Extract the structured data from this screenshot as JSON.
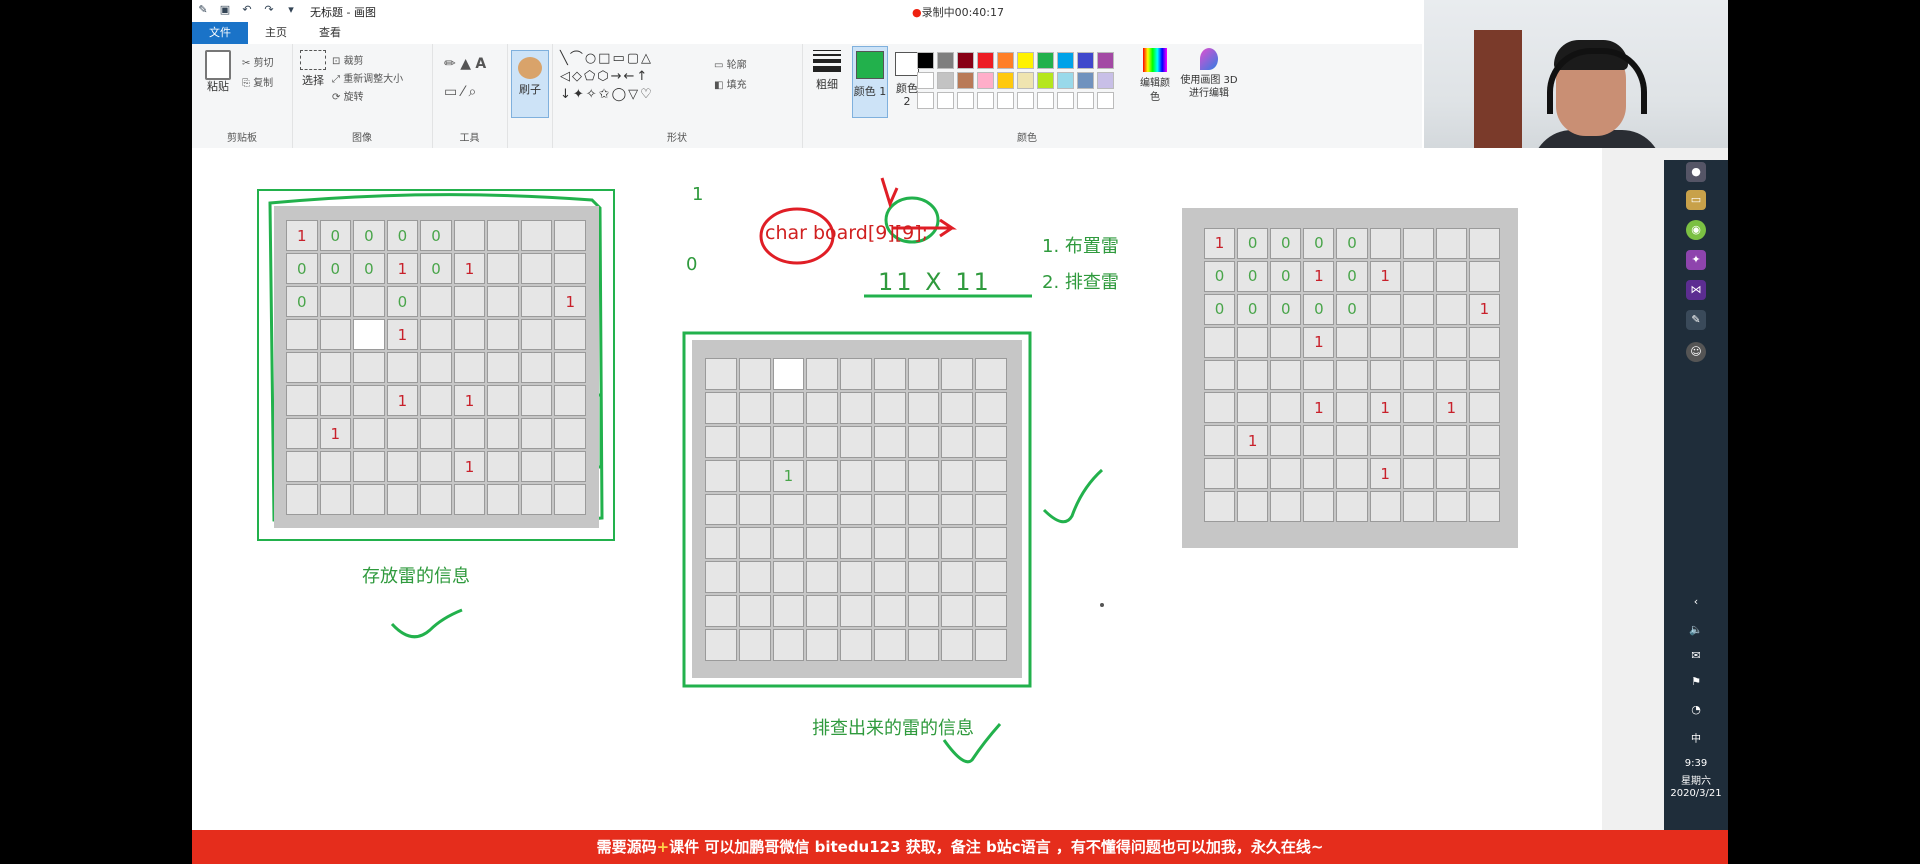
{
  "titlebar": {
    "title": "无标题 - 画图",
    "recording": "录制中00:40:17"
  },
  "tabs": [
    "文件",
    "主页",
    "查看"
  ],
  "ribbon": {
    "clipboard": {
      "paste": "粘贴",
      "cut": "剪切",
      "copy": "复制",
      "label": "剪贴板"
    },
    "image": {
      "select": "选择",
      "crop": "裁剪",
      "resize": "重新调整大小",
      "rotate": "旋转",
      "label": "图像"
    },
    "tools": {
      "label": "工具"
    },
    "brushes": {
      "label": "刷子"
    },
    "shapes": {
      "outline": "轮廓",
      "fill": "填充",
      "label": "形状"
    },
    "size": {
      "label": "粗细"
    },
    "color1": {
      "label": "颜色 1"
    },
    "color2": {
      "label": "颜色 2"
    },
    "colors": {
      "label": "颜色"
    },
    "edit_colors": "编辑颜色",
    "paint3d": "使用画图 3D 进行编辑"
  },
  "palette": {
    "row1": [
      "#000000",
      "#7f7f7f",
      "#880015",
      "#ed1c24",
      "#ff7f27",
      "#fff200",
      "#22b14c",
      "#00a2e8",
      "#3f48cc",
      "#a349a4"
    ],
    "row2": [
      "#ffffff",
      "#c3c3c3",
      "#b97a57",
      "#ffaec9",
      "#ffc90e",
      "#efe4b0",
      "#b5e61d",
      "#99d9ea",
      "#7092be",
      "#c8bfe7"
    ],
    "selected": "#22b14c"
  },
  "canvas": {
    "board_left": [
      [
        "1",
        "0",
        "0",
        "0",
        "0",
        "",
        "",
        "",
        ""
      ],
      [
        "0",
        "0",
        "0",
        "1",
        "0",
        "1",
        "",
        "",
        ""
      ],
      [
        "0",
        "",
        "",
        "0",
        "",
        "",
        "",
        "",
        "1"
      ],
      [
        "",
        "",
        "",
        "1",
        "",
        "",
        "",
        "",
        ""
      ],
      [
        "",
        "",
        "",
        "",
        "",
        "",
        "",
        "",
        ""
      ],
      [
        "",
        "",
        "",
        "1",
        "",
        "1",
        "",
        "",
        ""
      ],
      [
        "",
        "1",
        "",
        "",
        "",
        "",
        "",
        "",
        ""
      ],
      [
        "",
        "",
        "",
        "",
        "",
        "1",
        "",
        "",
        ""
      ],
      [
        "",
        "",
        "",
        "",
        "",
        "",
        "",
        "",
        ""
      ]
    ],
    "board_right": [
      [
        "1",
        "0",
        "0",
        "0",
        "0",
        "",
        "",
        "",
        ""
      ],
      [
        "0",
        "0",
        "0",
        "1",
        "0",
        "1",
        "",
        "",
        ""
      ],
      [
        "0",
        "0",
        "0",
        "0",
        "0",
        "",
        "",
        "",
        "1"
      ],
      [
        "",
        "",
        "",
        "1",
        "",
        "",
        "",
        "",
        ""
      ],
      [
        "",
        "",
        "",
        "",
        "",
        "",
        "",
        "",
        ""
      ],
      [
        "",
        "",
        "",
        "1",
        "",
        "1",
        "",
        "1",
        ""
      ],
      [
        "",
        "1",
        "",
        "",
        "",
        "",
        "",
        "",
        ""
      ],
      [
        "",
        "",
        "",
        "",
        "",
        "1",
        "",
        "",
        ""
      ],
      [
        "",
        "",
        "",
        "",
        "",
        "",
        "",
        "",
        ""
      ]
    ],
    "board_middle_mark": "1",
    "note_one": "1",
    "note_zero": "0",
    "code": "char board[9][9];",
    "step1": "1. 布置雷",
    "step2": "2. 排查雷",
    "formula": "11 X 11",
    "label_left": "存放雷的信息",
    "label_middle": "排查出来的雷的信息"
  },
  "taskbar": {
    "ime": "中",
    "time": "9:39",
    "weekday": "星期六",
    "date": "2020/3/21"
  },
  "banner": {
    "part1": "需要源码",
    "plus": "+",
    "part2": "课件 可以加鹏哥微信 bitedu123 获取，备注 b站c语言 ，有不懂得问题也可以加我，永久在线~"
  }
}
